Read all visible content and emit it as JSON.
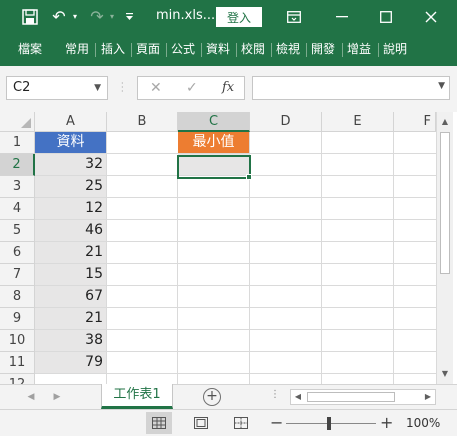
{
  "titlebar": {
    "filename": "min.xls...",
    "signin_label": "登入"
  },
  "ribbon_tabs": [
    "檔案",
    "常用",
    "插入",
    "頁面",
    "公式",
    "資料",
    "校閱",
    "檢視",
    "開發",
    "增益"
  ],
  "ribbon_more": "說明",
  "formula_bar": {
    "name_box": "C2",
    "formula": ""
  },
  "columns": [
    "A",
    "B",
    "C",
    "D",
    "E",
    "F"
  ],
  "rows": [
    "1",
    "2",
    "3",
    "4",
    "5",
    "6",
    "7",
    "8",
    "9",
    "10",
    "11",
    "12"
  ],
  "cells": {
    "A1": "資料",
    "C1": "最小值",
    "A_values": [
      "32",
      "25",
      "12",
      "46",
      "21",
      "15",
      "67",
      "21",
      "38",
      "79"
    ]
  },
  "selected_cell": "C2",
  "sheet_tab": "工作表1",
  "zoom": "100%",
  "colors": {
    "accent": "#217346",
    "header_a": "#4472c4",
    "header_c": "#ed7d31",
    "data_fill": "#e7e6e6"
  }
}
